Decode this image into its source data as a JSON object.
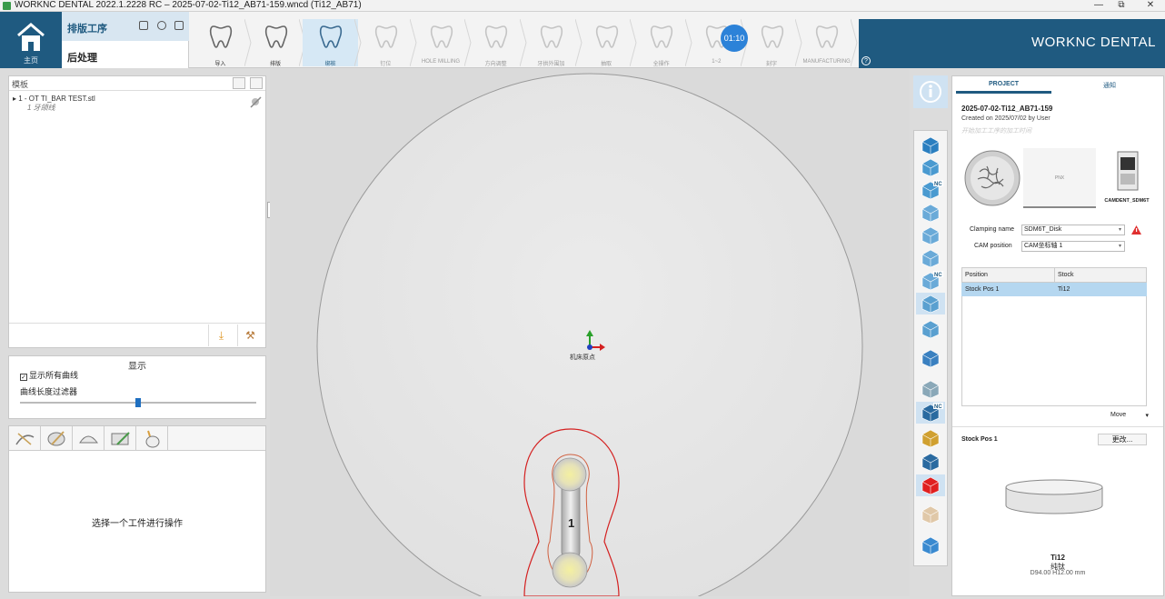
{
  "window": {
    "title": "WORKNC DENTAL 2022.1.2228 RC – 2025-07-02-Ti12_AB71-159.wncd (Ti12_AB71)",
    "controls": [
      "—",
      "⧉",
      "✕"
    ]
  },
  "ribbon": {
    "home_label": "主页",
    "task_active": "排版工序",
    "task_next": "后处理",
    "timer": "01:10",
    "steps": [
      {
        "label": "导入",
        "state": "done"
      },
      {
        "label": "排版",
        "state": "done"
      },
      {
        "label": "绑桩",
        "state": "active"
      },
      {
        "label": "钉位",
        "state": "pending"
      },
      {
        "label": "HOLE MILLING",
        "state": "pending"
      },
      {
        "label": "方向调整",
        "state": "pending"
      },
      {
        "label": "牙拱外围加",
        "state": "pending"
      },
      {
        "label": "抽取",
        "state": "pending"
      },
      {
        "label": "全操作",
        "state": "pending"
      },
      {
        "label": "1~2",
        "state": "pending"
      },
      {
        "label": "刻字",
        "state": "pending"
      },
      {
        "label": "MANUFACTURING",
        "state": "pending"
      }
    ],
    "brand": "WORKNC DENTAL",
    "help": "?"
  },
  "models_panel": {
    "header": "模板",
    "items": [
      {
        "name": "1 - OT TI_BAR TEST.stl",
        "sub": "1 牙颌线"
      }
    ]
  },
  "display_panel": {
    "title": "显示",
    "show_all_curves": "显示所有曲线",
    "show_all_checked": true,
    "length_filter": "曲线长度过滤器",
    "filter_value": 0.52
  },
  "ops_panel": {
    "message": "选择一个工件进行操作"
  },
  "viewport": {
    "origin_label": "机床原点",
    "part_number": "1"
  },
  "right_panel": {
    "tab_project": "PROJECT",
    "tab_other": "通知",
    "project_name": "2025-07-02-Ti12_AB71-159",
    "created": "Created on 2025/07/02 by User",
    "faint_note": "开始加工工序的加工时间",
    "card_middle_label": "PNX",
    "machine_label": "CAMDENT_SDM6T",
    "clamping_label": "Clamping name",
    "clamping_value": "SDM6T_Disk",
    "cam_label": "CAM position",
    "cam_value": "CAM坐标轴 1",
    "table_headers": [
      "Position",
      "Stock"
    ],
    "table_rows": [
      [
        "Stock Pos 1",
        "Ti12"
      ]
    ],
    "move": "Move",
    "stock_pos": "Stock Pos 1",
    "change": "更改...",
    "material": "Ti12",
    "material_cn": "纯钛",
    "dims": "D94.00 H12.00 mm"
  },
  "colors": {
    "brand": "#1f5a80",
    "accent": "#2c82d8",
    "selection": "#b5d7f0",
    "toolpath": "#d42020"
  }
}
